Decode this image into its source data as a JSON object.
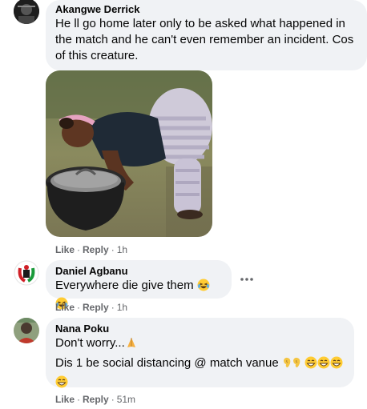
{
  "comments": [
    {
      "author": "Akangwe Derrick",
      "lines": [
        "He ll go home later only to be asked what happened in",
        "the match and he can't even remember an incident. Cos",
        "of this creature."
      ],
      "like": "Like",
      "reply": "Reply",
      "time": "1h"
    },
    {
      "author": "Daniel Agbanu",
      "text": "Everywhere die give them",
      "like": "Like",
      "reply": "Reply",
      "time": "1h"
    },
    {
      "author": "Nana Poku",
      "line1": "Don't worry...",
      "line2": "Dis 1 be social distancing @ match vanue",
      "like": "Like",
      "reply": "Reply",
      "time": "51m"
    }
  ],
  "icons": {
    "more": "more-options-icon",
    "laugh": "laughing-emoji",
    "pray": "praying-hands-emoji",
    "ear": "ear-emoji",
    "grin": "grinning-emoji"
  },
  "colors": {
    "bubble": "#f0f2f5",
    "meta": "#65676b",
    "text": "#050505"
  }
}
